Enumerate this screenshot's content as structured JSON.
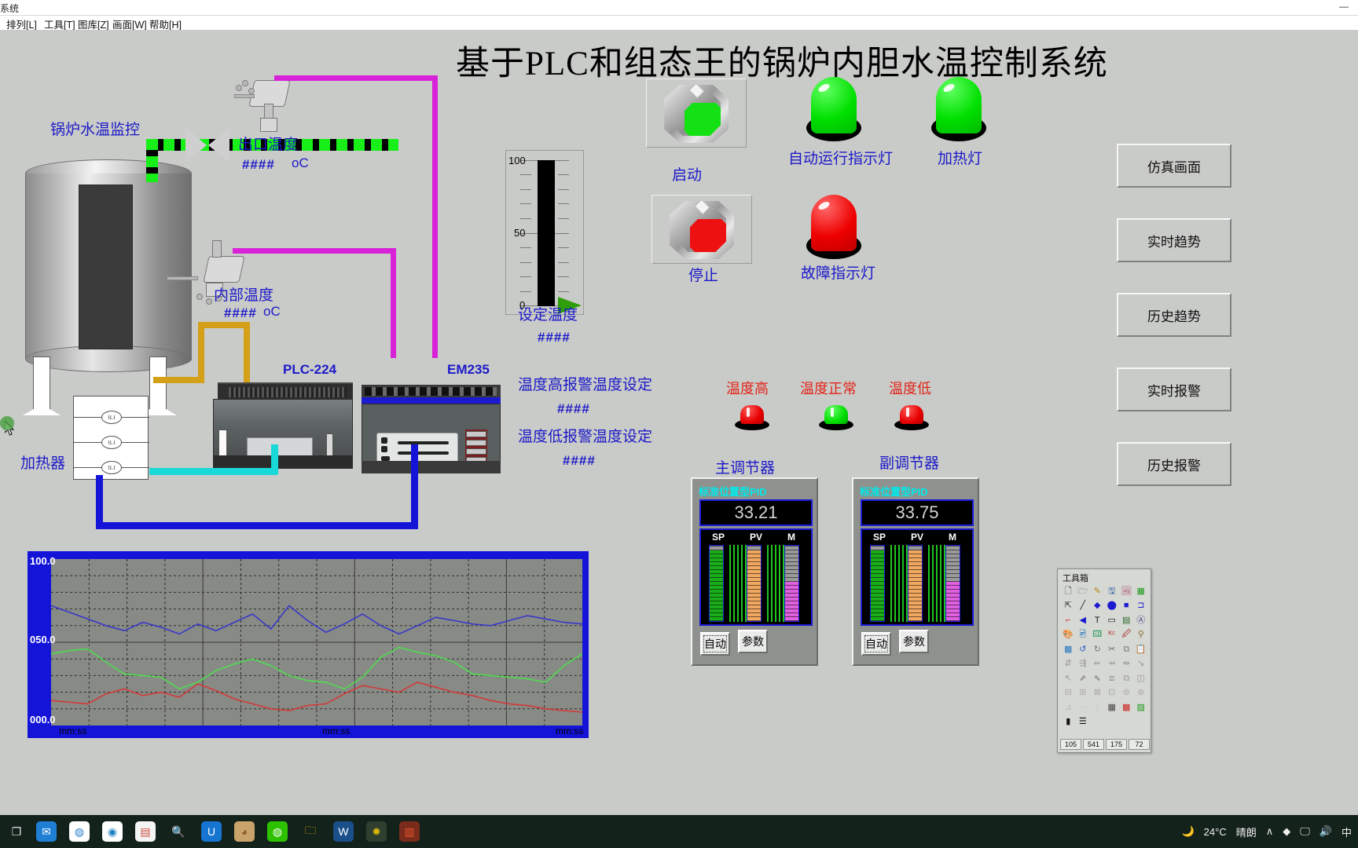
{
  "window": {
    "title": "系统",
    "buttons": [
      "—",
      "▫",
      "✕"
    ]
  },
  "menubar": [
    {
      "label": "排列[L]"
    },
    {
      "label": "工具[T]"
    },
    {
      "label": "图库[Z]"
    },
    {
      "label": "画面[W]"
    },
    {
      "label": "帮助[H]"
    }
  ],
  "main": {
    "title": "基于PLC和组态王的锅炉内胆水温控制系统",
    "boiler_label": "锅炉水温监控",
    "outlet_temp_label": "出口温度",
    "outlet_temp_value": "####",
    "outlet_temp_unit": "oC",
    "inner_temp_label": "内部温度",
    "inner_temp_value": "####",
    "inner_temp_unit": "oC",
    "heater_label": "加热器",
    "plc_label": "PLC-224",
    "em_label": "EM235",
    "set_temp_label": "设定温度",
    "set_temp_value": "####",
    "high_alarm_label": "温度高报警温度设定",
    "high_alarm_value": "####",
    "low_alarm_label": "温度低报警温度设定",
    "low_alarm_value": "####",
    "start_button_label": "启动",
    "stop_button_label": "停止",
    "auto_run_lamp_label": "自动运行指示灯",
    "heating_lamp_label": "加热灯",
    "fault_lamp_label": "故障指示灯",
    "temp_high_label": "温度高",
    "temp_normal_label": "温度正常",
    "temp_low_label": "温度低"
  },
  "gauge": {
    "max_label": "100",
    "mid_label": "50",
    "min_label": "0",
    "value": 100
  },
  "nav_buttons": [
    {
      "label": "仿真画面"
    },
    {
      "label": "实时趋势"
    },
    {
      "label": "历史趋势"
    },
    {
      "label": "实时报警"
    },
    {
      "label": "历史报警"
    }
  ],
  "pid_controllers": [
    {
      "caption": "主调节器",
      "title": "标准位置型PID",
      "pv_value": "33.21",
      "bar_labels": [
        "SP",
        "PV",
        "M"
      ],
      "bar_values": [
        100,
        100,
        52
      ],
      "buttons": [
        "自动",
        "参数"
      ]
    },
    {
      "caption": "副调节器",
      "title": "标准位置型PID",
      "pv_value": "33.75",
      "bar_labels": [
        "SP",
        "PV",
        "M"
      ],
      "bar_values": [
        100,
        100,
        52
      ],
      "buttons": [
        "自动",
        "参数"
      ]
    }
  ],
  "chart_data": {
    "type": "line",
    "title": "",
    "xlabel": "",
    "ylabel": "",
    "ylim": [
      0,
      100
    ],
    "y_ticks": [
      "100.0",
      "050.0",
      "000.0"
    ],
    "x_ticks": [
      "mm:ss",
      "mm:ss",
      "mm:ss"
    ],
    "grid": true,
    "series": [
      {
        "name": "trend-blue",
        "color": "#3838c8",
        "values": [
          72,
          68,
          64,
          60,
          57,
          62,
          59,
          55,
          61,
          57,
          62,
          67,
          58,
          72,
          63,
          56,
          61,
          67,
          60,
          55,
          60,
          65,
          63,
          61,
          60,
          63,
          66,
          64,
          62,
          61
        ]
      },
      {
        "name": "trend-green",
        "color": "#4fdc4f",
        "values": [
          43,
          45,
          46,
          38,
          31,
          30,
          29,
          22,
          26,
          33,
          37,
          40,
          36,
          30,
          27,
          26,
          22,
          29,
          41,
          47,
          44,
          42,
          38,
          31,
          30,
          29,
          28,
          26,
          36,
          43
        ]
      },
      {
        "name": "trend-red",
        "color": "#d23a3a",
        "values": [
          15,
          14,
          13,
          19,
          22,
          18,
          20,
          17,
          25,
          21,
          16,
          13,
          10,
          9,
          12,
          13,
          19,
          24,
          22,
          20,
          26,
          23,
          20,
          18,
          15,
          13,
          12,
          10,
          9,
          8
        ]
      }
    ]
  },
  "toolbox": {
    "title": "工具箱",
    "icons": [
      "new-file-icon",
      "open-file-icon",
      "pencil-icon",
      "save-icon",
      "picture-icon",
      "table-icon",
      "pointer-icon",
      "line-icon",
      "polygon-icon",
      "ellipse-icon",
      "rectangle-icon",
      "rounded-rect-icon",
      "polyline-icon",
      "arc-icon",
      "text-icon",
      "round-rect-icon",
      "paste-special-icon",
      "arrow-icon",
      "paint-icon",
      "image-insert-icon",
      "image-frame-icon",
      "abc-icon",
      "pick-icon",
      "link-icon",
      "color-palette-icon",
      "undo-icon",
      "redo-icon",
      "cut-icon",
      "copy-icon",
      "paste-icon",
      "align-left-icon",
      "align-center-icon",
      "align-right-icon",
      "align-top-icon",
      "align-mid-icon",
      "align-bottom-icon",
      "group-icon",
      "ungroup-icon",
      "bring-front-icon",
      "send-back-icon",
      "flip-h-icon",
      "flip-v-icon",
      "dist-h-icon",
      "dist-v-icon",
      "space-h-icon",
      "space-v-icon",
      "rotate-left-icon",
      "rotate-right-icon",
      "layer-icon",
      "dotted-line-icon",
      "dot-line-icon",
      "grid-icon",
      "palette-icon",
      "fill-pattern-icon",
      "line-style-icon",
      "line-weight-icon"
    ],
    "status": [
      "105",
      "541",
      "175",
      "72"
    ]
  },
  "taskbar": {
    "items": [
      {
        "name": "task-view-icon",
        "glyph": "❐",
        "color": "#e6e6e6",
        "bg": "transparent"
      },
      {
        "name": "mail-icon",
        "glyph": "✉",
        "color": "#ffffff",
        "bg": "#1f7fd4"
      },
      {
        "name": "browser-icon",
        "glyph": "◍",
        "color": "#2f7fd0",
        "bg": "#ffffff"
      },
      {
        "name": "edge-icon",
        "glyph": "◉",
        "color": "#1a7fc1",
        "bg": "#ffffff"
      },
      {
        "name": "store-icon",
        "glyph": "▤",
        "color": "#d04a3a",
        "bg": "#f4f4f4"
      },
      {
        "name": "search-icon",
        "glyph": "🔍",
        "color": "#e8861b",
        "bg": "transparent"
      },
      {
        "name": "app-blue-icon",
        "glyph": "U",
        "color": "#ffffff",
        "bg": "#1675d1"
      },
      {
        "name": "photo-icon",
        "glyph": "◕",
        "color": "#8c5a2b",
        "bg": "#caa36a"
      },
      {
        "name": "wechat-icon",
        "glyph": "◍",
        "color": "#ffffff",
        "bg": "#2dc100"
      },
      {
        "name": "explorer-icon",
        "glyph": "🗀",
        "color": "#f0b400",
        "bg": "transparent"
      },
      {
        "name": "word-icon",
        "glyph": "W",
        "color": "#ffffff",
        "bg": "#1b4f8a"
      },
      {
        "name": "kingview-icon",
        "glyph": "✹",
        "color": "#d4b106",
        "bg": "#2f3f2f"
      },
      {
        "name": "app-red-icon",
        "glyph": "▥",
        "color": "#e4572e",
        "bg": "#7a2b1b"
      }
    ],
    "weather_glyph": "🌙",
    "weather_temp": "24°C",
    "weather_desc": "晴朗",
    "tray_glyphs": [
      "∧",
      "◆",
      "🖵",
      "🔊",
      "中"
    ]
  }
}
